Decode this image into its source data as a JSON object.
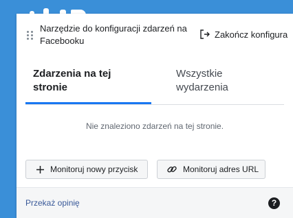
{
  "header": {
    "title": "Narzędzie do konfiguracji zdarzeń na Facebooku",
    "end_button_label": "Zakończ konfigura",
    "drag_icon": "drag-handle-icon",
    "exit_icon": "exit-icon"
  },
  "tabs": [
    {
      "label": "Zdarzenia na tej stronie",
      "active": true
    },
    {
      "label": "Wszystkie wydarzenia",
      "active": false
    }
  ],
  "main": {
    "empty_message": "Nie znaleziono zdarzeń na tej stronie."
  },
  "actions": {
    "track_button_label": "Monitoruj nowy przycisk",
    "track_button_icon": "plus-icon",
    "track_url_label": "Monitoruj adres URL",
    "track_url_icon": "link-icon"
  },
  "footer": {
    "feedback_label": "Przekaż opinię",
    "help_glyph": "?"
  },
  "colors": {
    "accent": "#1877f2",
    "background": "#3a8fd8",
    "panel": "#ffffff",
    "footer": "#f5f6f7",
    "link": "#385898"
  }
}
